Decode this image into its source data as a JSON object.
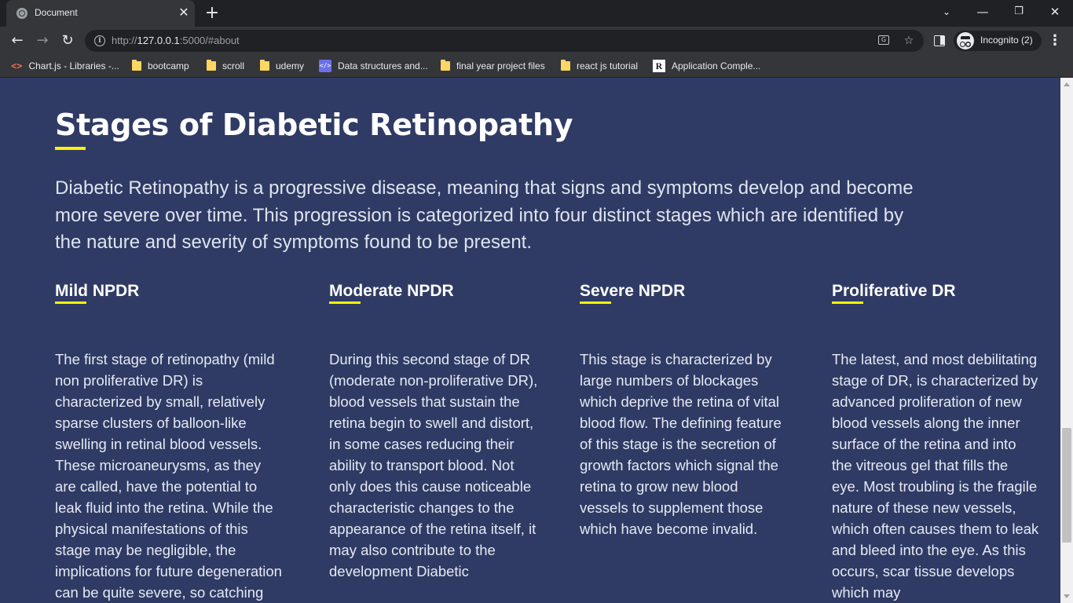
{
  "browser": {
    "tab_title": "Document",
    "url_scheme": "http://",
    "url_host": "127.0.0.1",
    "url_rest": ":5000/#about",
    "profile_label": "Incognito (2)"
  },
  "bookmarks": [
    {
      "label": "Chart.js - Libraries -...",
      "icon": "code-brackets-icon"
    },
    {
      "label": "bootcamp",
      "icon": "folder-icon"
    },
    {
      "label": "scroll",
      "icon": "folder-icon"
    },
    {
      "label": "udemy",
      "icon": "folder-icon"
    },
    {
      "label": "Data structures and...",
      "icon": "code-icon"
    },
    {
      "label": "final year project files",
      "icon": "folder-icon"
    },
    {
      "label": "react js tutorial",
      "icon": "folder-icon"
    },
    {
      "label": "Application Comple...",
      "icon": "r-logo-icon"
    }
  ],
  "page": {
    "title": "Stages of Diabetic Retinopathy",
    "intro": "Diabetic Retinopathy is a progressive disease, meaning that signs and symptoms develop and become more severe over time. This progression is categorized into four distinct stages which are identified by the nature and severity of symptoms found to be present.",
    "stages": [
      {
        "title": "Mild NPDR",
        "text": "The first stage of retinopathy (mild non proliferative DR) is characterized by small, relatively sparse clusters of balloon-like swelling in retinal blood vessels. These microaneurysms, as they are called, have the potential to leak fluid into the retina. While the physical manifestations of this stage may be negligible, the implications for future degeneration can be quite severe, so catching and treating"
      },
      {
        "title": "Moderate NPDR",
        "text": "During this second stage of DR (moderate non-proliferative DR), blood vessels that sustain the retina begin to swell and distort, in some cases reducing their ability to transport blood. Not only does this cause noticeable characteristic changes to the appearance of the retina itself, it may also contribute to the development Diabetic"
      },
      {
        "title": "Severe NPDR",
        "text": "This stage is characterized by large numbers of blockages which deprive the retina of vital blood flow. The defining feature of this stage is the secretion of growth factors which signal the retina to grow new blood vessels to supplement those which have become invalid."
      },
      {
        "title": "Proliferative DR",
        "text": "The latest, and most debilitating stage of DR, is characterized by advanced proliferation of new blood vessels along the inner surface of the retina and into the vitreous gel that fills the eye. Most troubling is the fragile nature of these new vessels, which often causes them to leak and bleed into the eye. As this occurs, scar tissue develops which may"
      }
    ]
  },
  "colors": {
    "page_background": "#2f3b64",
    "accent_underline": "#fff200",
    "heading": "#ffffff"
  }
}
